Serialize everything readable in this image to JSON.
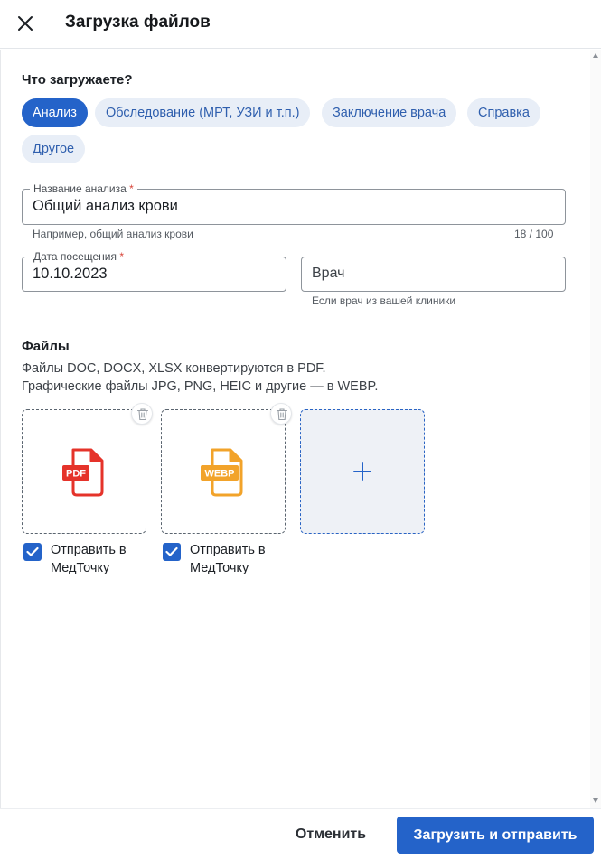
{
  "header": {
    "title": "Загрузка файлов",
    "close_icon": "close-icon"
  },
  "type_section": {
    "title": "Что загружаете?",
    "chips": [
      {
        "label": "Анализ",
        "selected": true
      },
      {
        "label": "Обследование (МРТ, УЗИ и т.п.)",
        "selected": false
      },
      {
        "label": "Заключение врача",
        "selected": false
      },
      {
        "label": "Справка",
        "selected": false
      },
      {
        "label": "Другое",
        "selected": false
      }
    ]
  },
  "form": {
    "name_field": {
      "label": "Название анализа",
      "required_mark": "*",
      "value": "Общий анализ крови",
      "helper": "Например, общий анализ крови",
      "counter": "18 / 100"
    },
    "date_field": {
      "label": "Дата посещения",
      "required_mark": "*",
      "value": "10.10.2023"
    },
    "doctor_field": {
      "placeholder": "Врач",
      "helper": "Если врач из вашей клиники"
    }
  },
  "files": {
    "title": "Файлы",
    "description_line1": "Файлы DOC, DOCX, XLSX конвертируются в PDF.",
    "description_line2": "Графические файлы JPG, PNG, HEIC и другие — в WEBP.",
    "items": [
      {
        "badge": "PDF",
        "color": "#e5332a",
        "send_checked": true,
        "send_label": "Отправить в МедТочку"
      },
      {
        "badge": "WEBP",
        "color": "#f2a32a",
        "send_checked": true,
        "send_label": "Отправить в МедТочку"
      }
    ],
    "add_icon": "plus-icon",
    "delete_icon": "trash-icon"
  },
  "footer": {
    "cancel_label": "Отменить",
    "submit_label": "Загрузить и отправить"
  },
  "colors": {
    "accent": "#2463c9",
    "chip_bg": "#e8eef7",
    "required": "#d8453a"
  }
}
